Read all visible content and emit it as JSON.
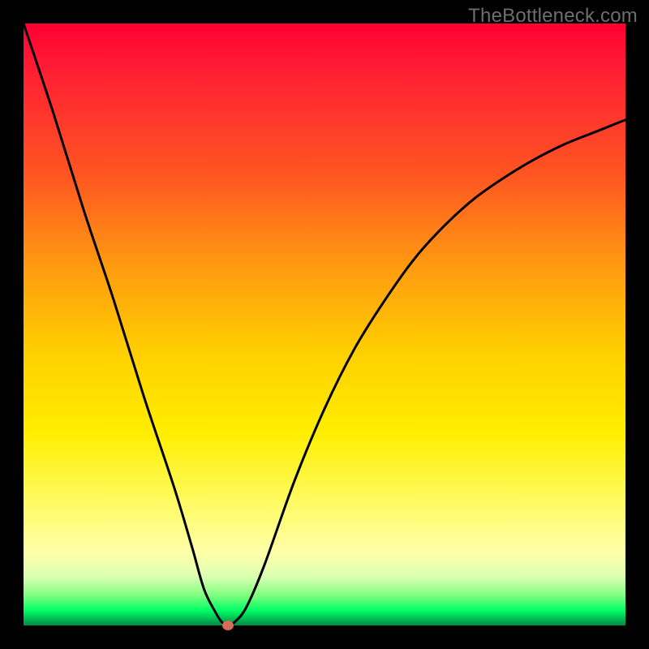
{
  "watermark": "TheBottleneck.com",
  "chart_data": {
    "type": "line",
    "title": "",
    "xlabel": "",
    "ylabel": "",
    "xlim": [
      0,
      100
    ],
    "ylim": [
      0,
      100
    ],
    "legend": false,
    "grid": false,
    "background_gradient": {
      "top_color": "#ff0033",
      "bottom_color": "#008844",
      "description": "red-to-green vertical gradient (bottleneck severity scale)"
    },
    "series": [
      {
        "name": "bottleneck-curve",
        "color": "#000000",
        "x": [
          0,
          5,
          10,
          15,
          20,
          25,
          28,
          30,
          32,
          33,
          34,
          35,
          37,
          40,
          45,
          50,
          55,
          60,
          65,
          70,
          75,
          80,
          85,
          90,
          95,
          100
        ],
        "values": [
          100,
          85,
          69,
          54,
          38,
          23,
          13,
          6,
          2,
          0.5,
          0,
          0.5,
          3,
          10,
          24,
          36,
          46,
          54,
          61,
          66.5,
          71,
          74.5,
          77.5,
          80,
          82,
          84
        ]
      }
    ],
    "marker": {
      "name": "optimal-point",
      "x": 34,
      "y": 0,
      "color": "#d96a5a"
    }
  }
}
